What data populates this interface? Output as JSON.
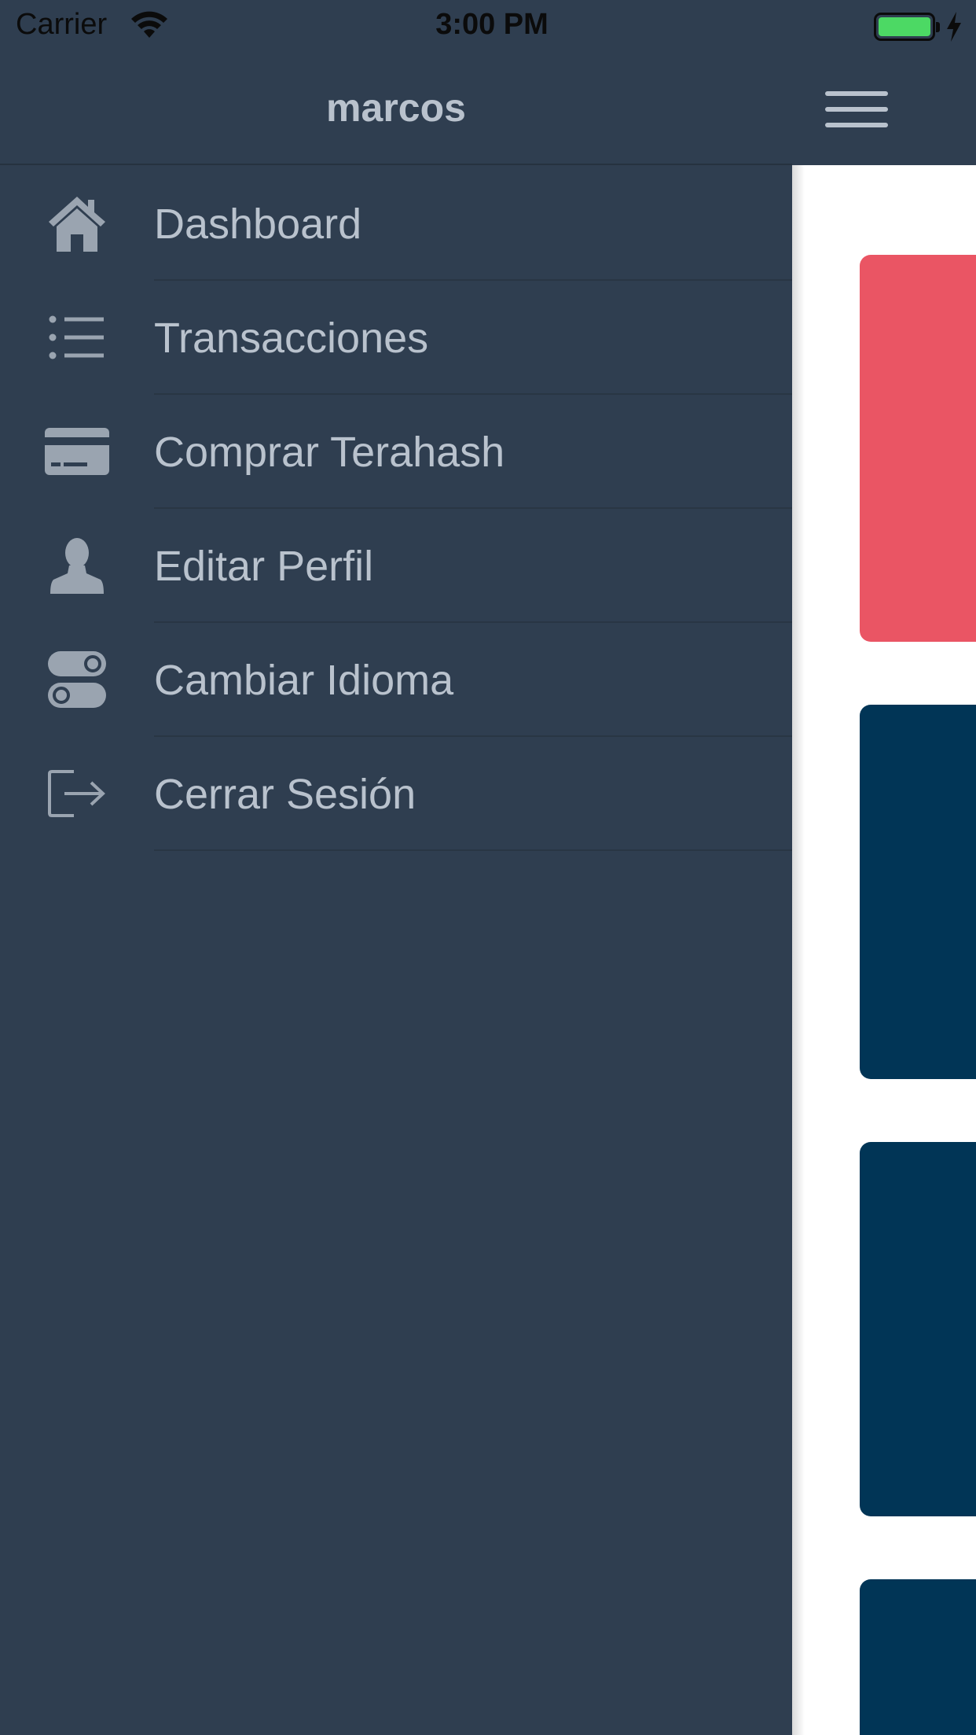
{
  "status_bar": {
    "carrier": "Carrier",
    "time": "3:00 PM",
    "battery_color": "#4cd964"
  },
  "drawer": {
    "username": "marcos",
    "items": [
      {
        "label": "Dashboard",
        "icon": "home-icon"
      },
      {
        "label": "Transacciones",
        "icon": "list-icon"
      },
      {
        "label": "Comprar Terahash",
        "icon": "credit-card-icon"
      },
      {
        "label": "Editar Perfil",
        "icon": "user-icon"
      },
      {
        "label": "Cambiar Idioma",
        "icon": "toggles-icon"
      },
      {
        "label": "Cerrar Sesión",
        "icon": "logout-icon"
      }
    ]
  },
  "content": {
    "menu_icon": "hamburger-icon",
    "card_colors": [
      "#ea5564",
      "#013556",
      "#013556",
      "#013556"
    ]
  },
  "theme": {
    "drawer_bg": "#2f3e50",
    "text_color": "#b9c2cd",
    "icon_color": "#9aa4b0"
  }
}
